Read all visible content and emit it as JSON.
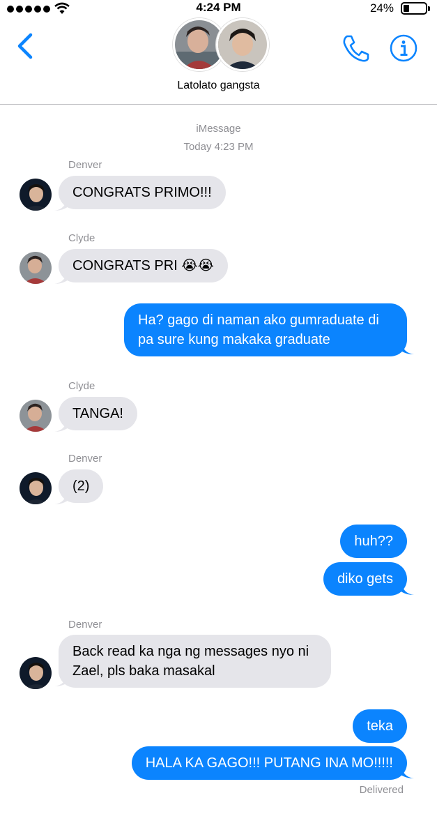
{
  "status_bar": {
    "time": "4:24 PM",
    "battery": "24%"
  },
  "header": {
    "group_name": "Latolato gangsta"
  },
  "thread": {
    "service": "iMessage",
    "timestamp": "Today 4:23 PM",
    "messages": [
      {
        "sender": "Denver",
        "text": "CONGRATS PRIMO!!!"
      },
      {
        "sender": "Clyde",
        "text": "CONGRATS PRI 😭😭"
      },
      {
        "text_line1": "Ha? gago di naman ako gumraduate di",
        "text_line2": "pa sure kung makaka graduate"
      },
      {
        "sender": "Clyde",
        "text": "TANGA!"
      },
      {
        "sender": "Denver",
        "text": "(2)"
      },
      {
        "text": "huh??"
      },
      {
        "text": "diko gets"
      },
      {
        "sender": "Denver",
        "text_line1": "Back read ka nga ng messages nyo ni",
        "text_line2": "Zael, pls baka masakal"
      },
      {
        "text": "teka"
      },
      {
        "text": "HALA KA GAGO!!! PUTANG INA MO!!!!!"
      }
    ],
    "delivery_status": "Delivered"
  },
  "colors": {
    "accent": "#0b84fe",
    "incoming_bubble": "#e5e5ea",
    "meta_text": "#8e8e93"
  },
  "icons": {
    "back": "chevron-left-icon",
    "call": "phone-icon",
    "details": "info-icon"
  }
}
